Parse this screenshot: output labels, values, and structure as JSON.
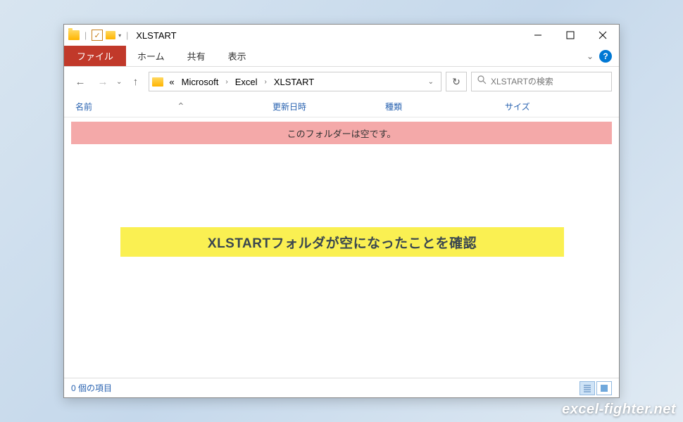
{
  "titlebar": {
    "title": "XLSTART"
  },
  "ribbon": {
    "file_tab": "ファイル",
    "tabs": [
      "ホーム",
      "共有",
      "表示"
    ]
  },
  "address": {
    "prefix": "«",
    "segments": [
      "Microsoft",
      "Excel",
      "XLSTART"
    ]
  },
  "search": {
    "placeholder": "XLSTARTの検索"
  },
  "columns": {
    "name": "名前",
    "date": "更新日時",
    "type": "種類",
    "size": "サイズ"
  },
  "content": {
    "empty_message": "このフォルダーは空です。"
  },
  "annotation": {
    "text": "XLSTARTフォルダが空になったことを確認"
  },
  "statusbar": {
    "item_count": "0 個の項目"
  },
  "watermark": "excel-fighter.net"
}
